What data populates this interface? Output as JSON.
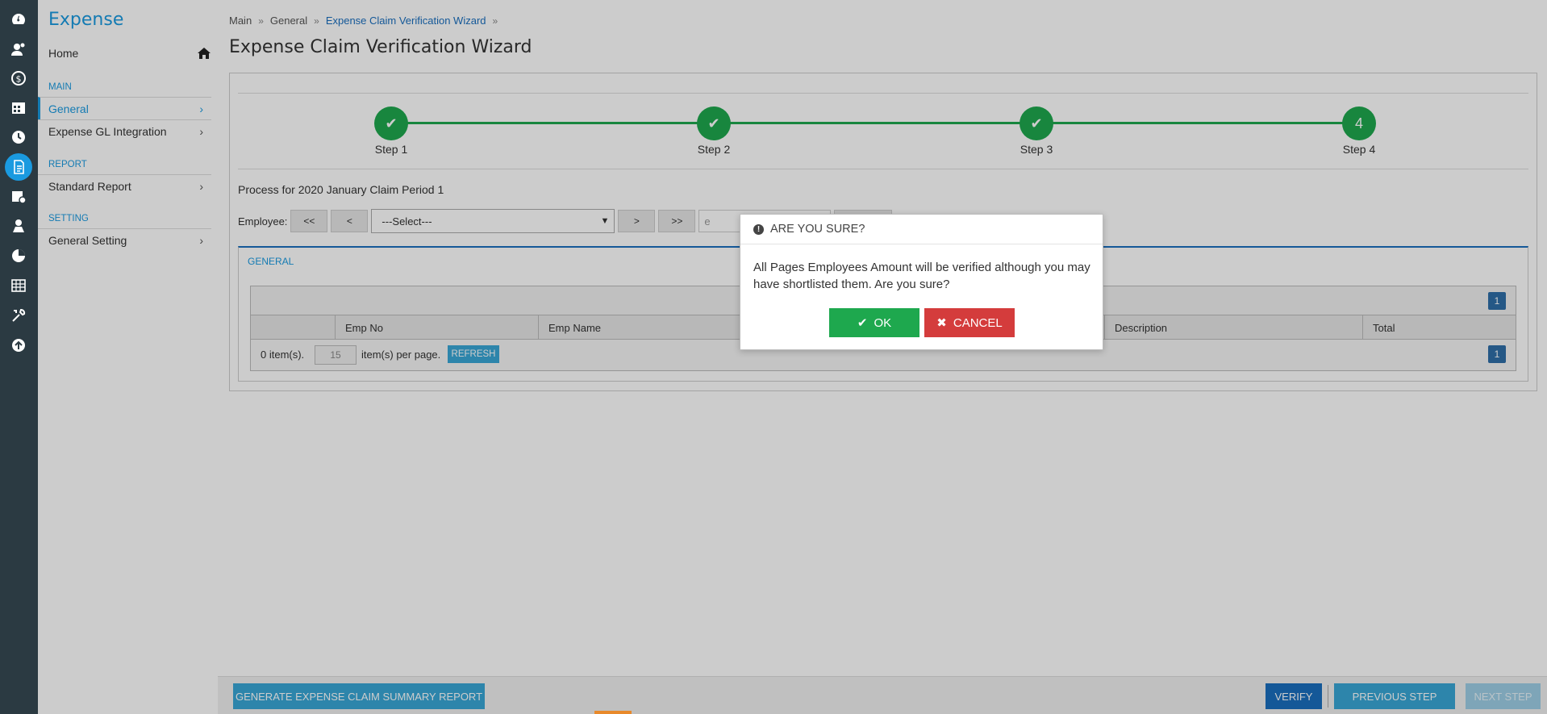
{
  "rail": {
    "icons": [
      "dashboard-icon",
      "user-icon",
      "money-icon",
      "calendar-icon",
      "clock-icon",
      "expense-icon",
      "calendar-time-icon",
      "person-icon",
      "chart-icon",
      "table-icon",
      "tools-icon",
      "upload-icon"
    ],
    "active_index": 5
  },
  "sidebar": {
    "title": "Expense",
    "home_label": "Home",
    "sections": [
      {
        "label": "MAIN",
        "items": [
          {
            "label": "General",
            "active": true
          },
          {
            "label": "Expense GL Integration",
            "active": false
          }
        ]
      },
      {
        "label": "REPORT",
        "items": [
          {
            "label": "Standard Report",
            "active": false
          }
        ]
      },
      {
        "label": "SETTING",
        "items": [
          {
            "label": "General Setting",
            "active": false
          }
        ]
      }
    ]
  },
  "breadcrumb": {
    "items": [
      "Main",
      "General",
      "Expense Claim Verification Wizard"
    ]
  },
  "page_title": "Expense Claim Verification Wizard",
  "wizard": {
    "steps": [
      {
        "label": "Step 1",
        "done": true
      },
      {
        "label": "Step 2",
        "done": true
      },
      {
        "label": "Step 3",
        "done": true
      },
      {
        "label": "Step 4",
        "done": false,
        "number": "4"
      }
    ],
    "accent_color": "#1ea84e"
  },
  "process_text": "Process for 2020 January Claim Period 1",
  "employee": {
    "label": "Employee:",
    "first": "<<",
    "prev": "<",
    "next": ">",
    "last": ">>",
    "select_value": "---Select---",
    "input_placeholder": "e"
  },
  "general": {
    "title": "GENERAL",
    "page_number": "1",
    "columns": [
      "",
      "Emp No",
      "Emp Name",
      "Description",
      "Total"
    ],
    "items_text": "0 item(s).",
    "page_size": "15",
    "per_page_text": "item(s) per page.",
    "refresh_label": "REFRESH"
  },
  "footer": {
    "generate_label": "GENERATE EXPENSE CLAIM SUMMARY REPORT",
    "verify_label": "VERIFY",
    "previous_label": "PREVIOUS STEP",
    "next_label": "NEXT STEP"
  },
  "dialog": {
    "title": "ARE YOU SURE?",
    "message": "All Pages Employees Amount will be verified although you may have shortlisted them. Are you sure?",
    "ok_label": "OK",
    "cancel_label": "CANCEL"
  }
}
